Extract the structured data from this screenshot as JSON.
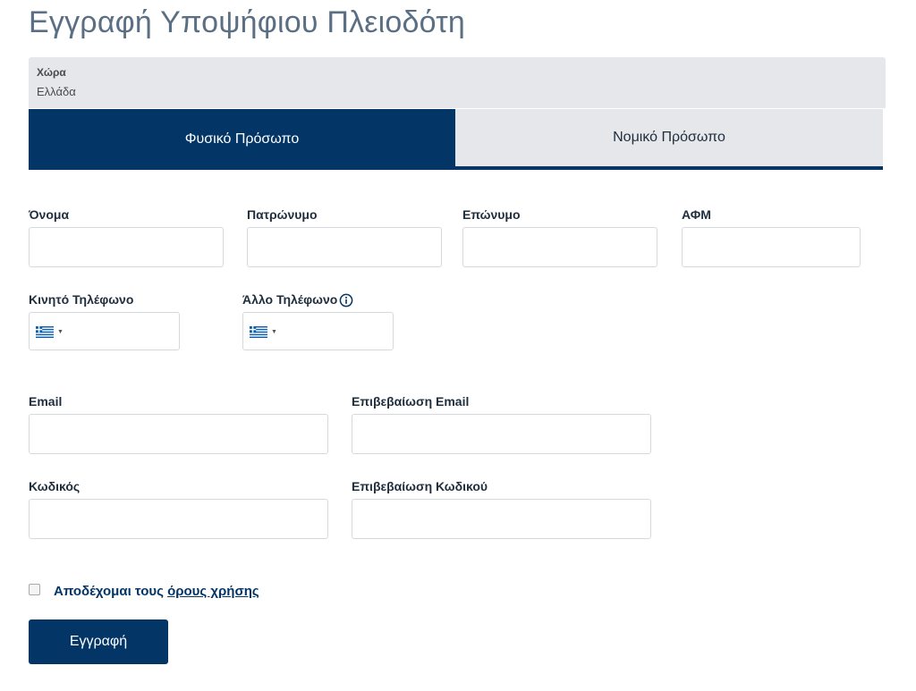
{
  "page": {
    "title": "Εγγραφή Υποψήφιου Πλειοδότη"
  },
  "country": {
    "label": "Χώρα",
    "value": "Ελλάδα"
  },
  "tabs": [
    {
      "label": "Φυσικό Πρόσωπο",
      "active": true
    },
    {
      "label": "Νομικό Πρόσωπο",
      "active": false
    }
  ],
  "fields": {
    "first_name": {
      "label": "Όνομα",
      "value": ""
    },
    "fathers_name": {
      "label": "Πατρώνυμο",
      "value": ""
    },
    "last_name": {
      "label": "Επώνυμο",
      "value": ""
    },
    "tax_id": {
      "label": "ΑΦΜ",
      "value": ""
    },
    "mobile_phone": {
      "label": "Κινητό Τηλέφωνο",
      "value": "",
      "flag": "greece-flag-icon"
    },
    "other_phone": {
      "label": "Άλλο Τηλέφωνο",
      "value": "",
      "flag": "greece-flag-icon",
      "info_icon": "info-icon"
    },
    "email": {
      "label": "Email",
      "value": ""
    },
    "email_confirm": {
      "label": "Επιβεβαίωση Email",
      "value": ""
    },
    "password": {
      "label": "Κωδικός",
      "value": ""
    },
    "password_confirm": {
      "label": "Επιβεβαίωση Κωδικού",
      "value": ""
    }
  },
  "terms": {
    "prefix": "Αποδέχομαι τους",
    "link": "όρους χρήσης",
    "checked": false
  },
  "submit": {
    "label": "Εγγραφή"
  },
  "colors": {
    "primary": "#033566",
    "title": "#5b6f84",
    "panel": "#e5e7eb",
    "border": "#d5d9de"
  }
}
